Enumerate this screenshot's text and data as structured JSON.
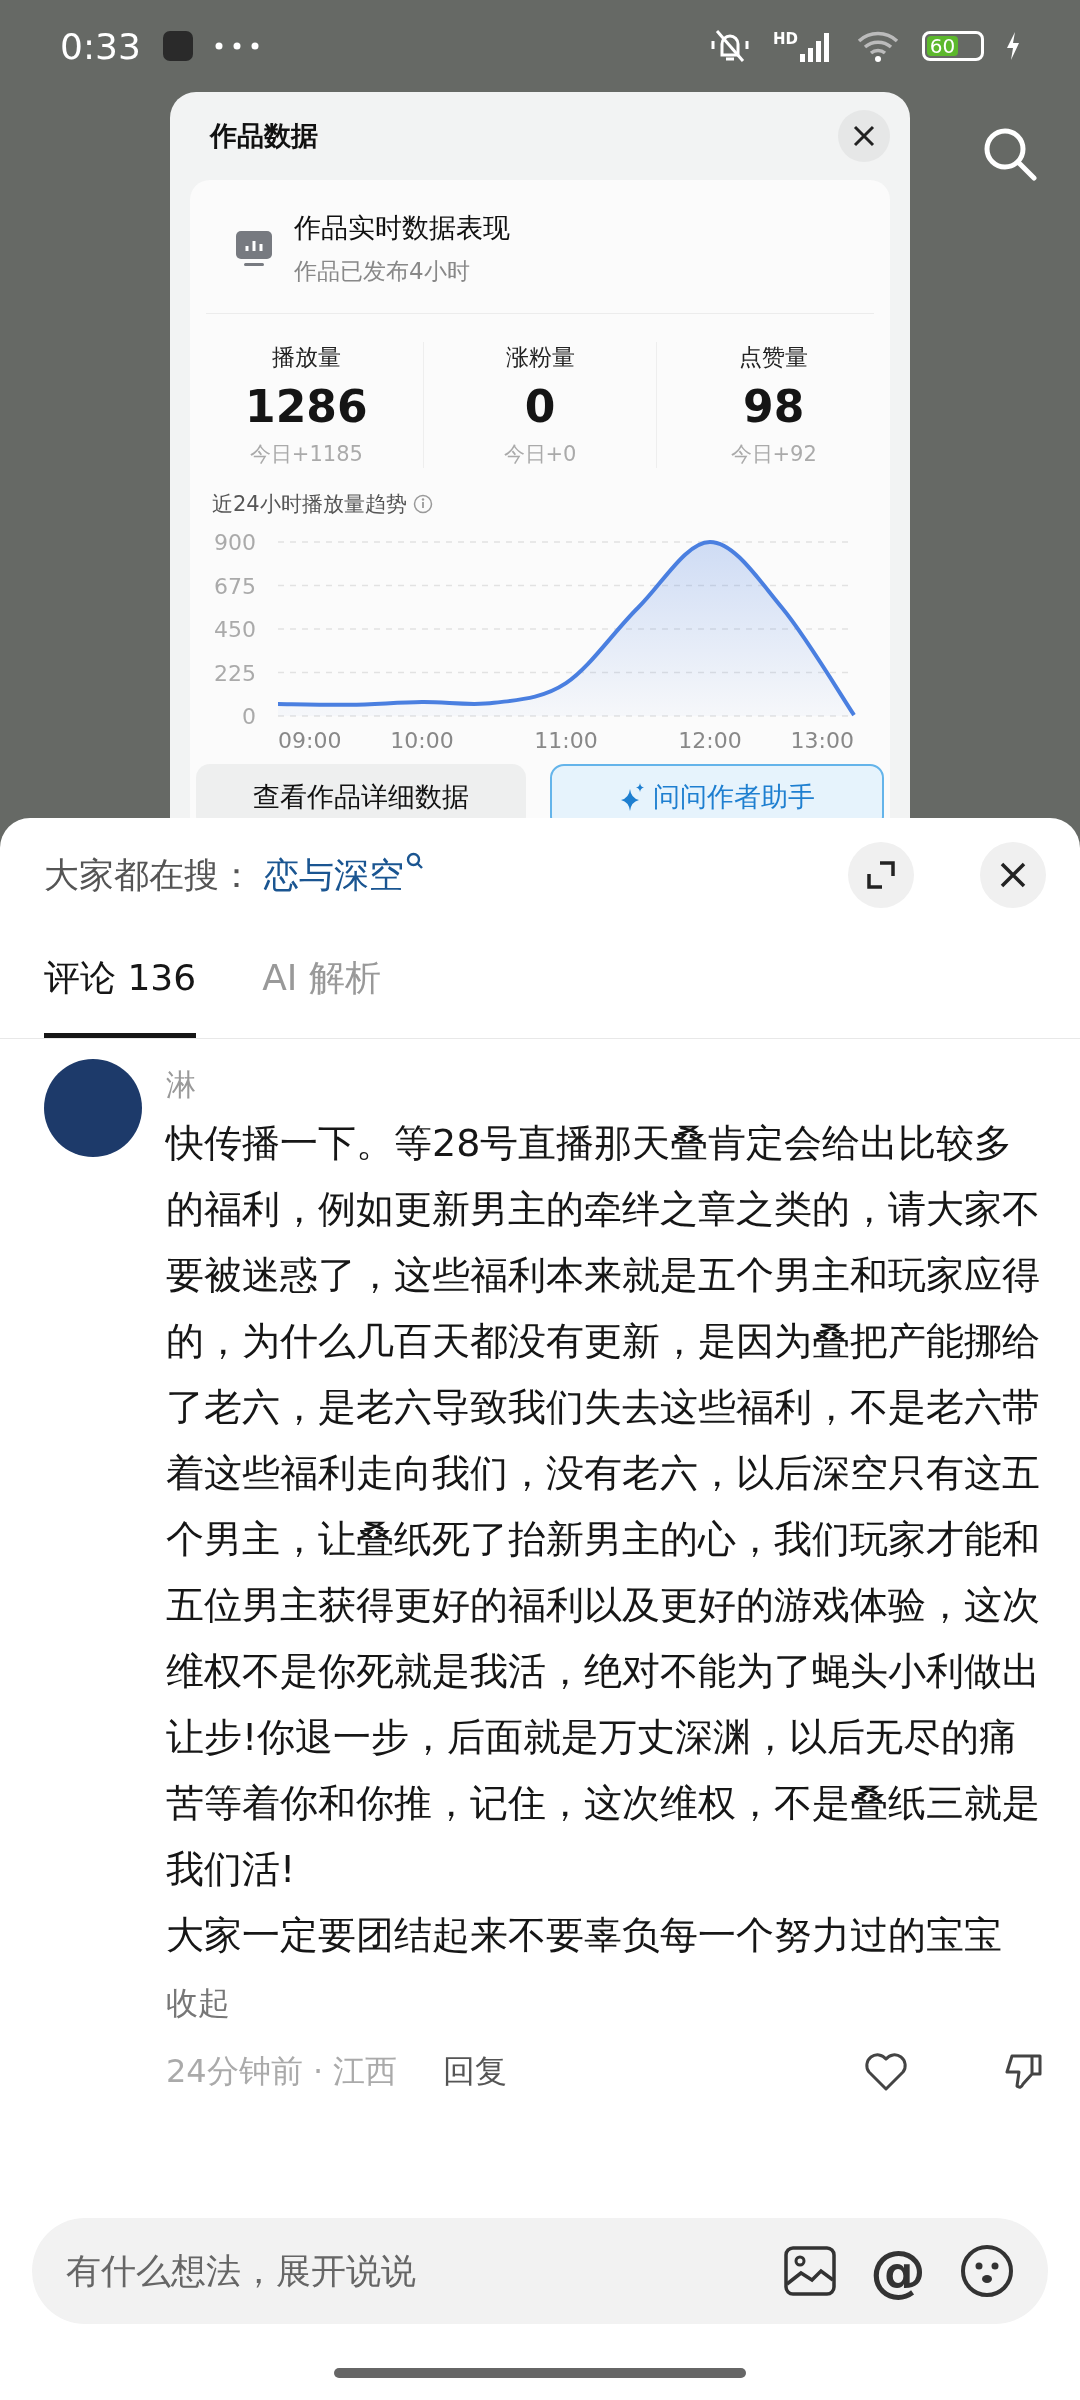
{
  "status_bar": {
    "time": "0:33",
    "network": "HD",
    "battery": "60"
  },
  "data_panel": {
    "title": "作品数据",
    "summary": {
      "title": "作品实时数据表现",
      "subtitle": "作品已发布4小时"
    },
    "stats": [
      {
        "label": "播放量",
        "value": "1286",
        "today": "今日+1185"
      },
      {
        "label": "涨粉量",
        "value": "0",
        "today": "今日+0"
      },
      {
        "label": "点赞量",
        "value": "98",
        "today": "今日+92"
      }
    ],
    "trend": {
      "title": "近24小时播放量趋势",
      "chart_data": {
        "type": "area",
        "x": [
          9,
          9.5,
          10,
          10.5,
          11,
          11.5,
          12,
          12.5,
          13
        ],
        "series": [
          {
            "color": "#4a7fe0",
            "values": [
              62,
              58,
              72,
              68,
              170,
              560,
              900,
              560,
              5
            ]
          }
        ],
        "grid": true,
        "ylim": [
          0,
          900
        ],
        "yticks": [
          0,
          225,
          450,
          675,
          900
        ],
        "xlim": [
          9,
          13
        ],
        "xticks": [
          {
            "value": 9,
            "label": "09:00"
          },
          {
            "value": 10,
            "label": "10:00"
          },
          {
            "value": 11,
            "label": "11:00"
          },
          {
            "value": 12,
            "label": "12:00"
          },
          {
            "value": 13,
            "label": "13:00"
          }
        ]
      }
    },
    "buttons": [
      {
        "kind": "plain",
        "label": "查看作品详细数据"
      },
      {
        "kind": "assistant",
        "label": "问问作者助手"
      }
    ]
  },
  "comments_sheet": {
    "trending": {
      "label": "大家都在搜：",
      "term": "恋与深空"
    },
    "tabs": [
      {
        "label": "评论 136",
        "selected": true
      },
      {
        "label": "AI 解析",
        "selected": false
      }
    ],
    "comments": [
      {
        "author": "淋",
        "paragraphs": [
          "快传播一下。等28号直播那天叠肯定会给出比较多的福利，例如更新男主的牵绊之章之类的，请大家不要被迷惑了，这些福利本来就是五个男主和玩家应得的，为什么几百天都没有更新，是因为叠把产能挪给了老六，是老六导致我们失去这些福利，不是老六带着这些福利走向我们，没有老六，以后深空只有这五个男主，让叠纸死了抬新男主的心，我们玩家才能和五位男主获得更好的福利以及更好的游戏体验，这次维权不是你死就是我活，绝对不能为了蝇头小利做出让步!你退一步，后面就是万丈深渊，以后无尽的痛苦等着你和你推，记住，这次维权，不是叠纸三就是我们活!",
          "大家一定要团结起来不要辜负每一个努力过的宝宝"
        ],
        "collapse": "收起",
        "time_location": "24分钟前 · 江西",
        "reply": "回复",
        "liked": false
      }
    ],
    "input": {
      "placeholder": "有什么想法，展开说说",
      "mention": "@"
    }
  }
}
